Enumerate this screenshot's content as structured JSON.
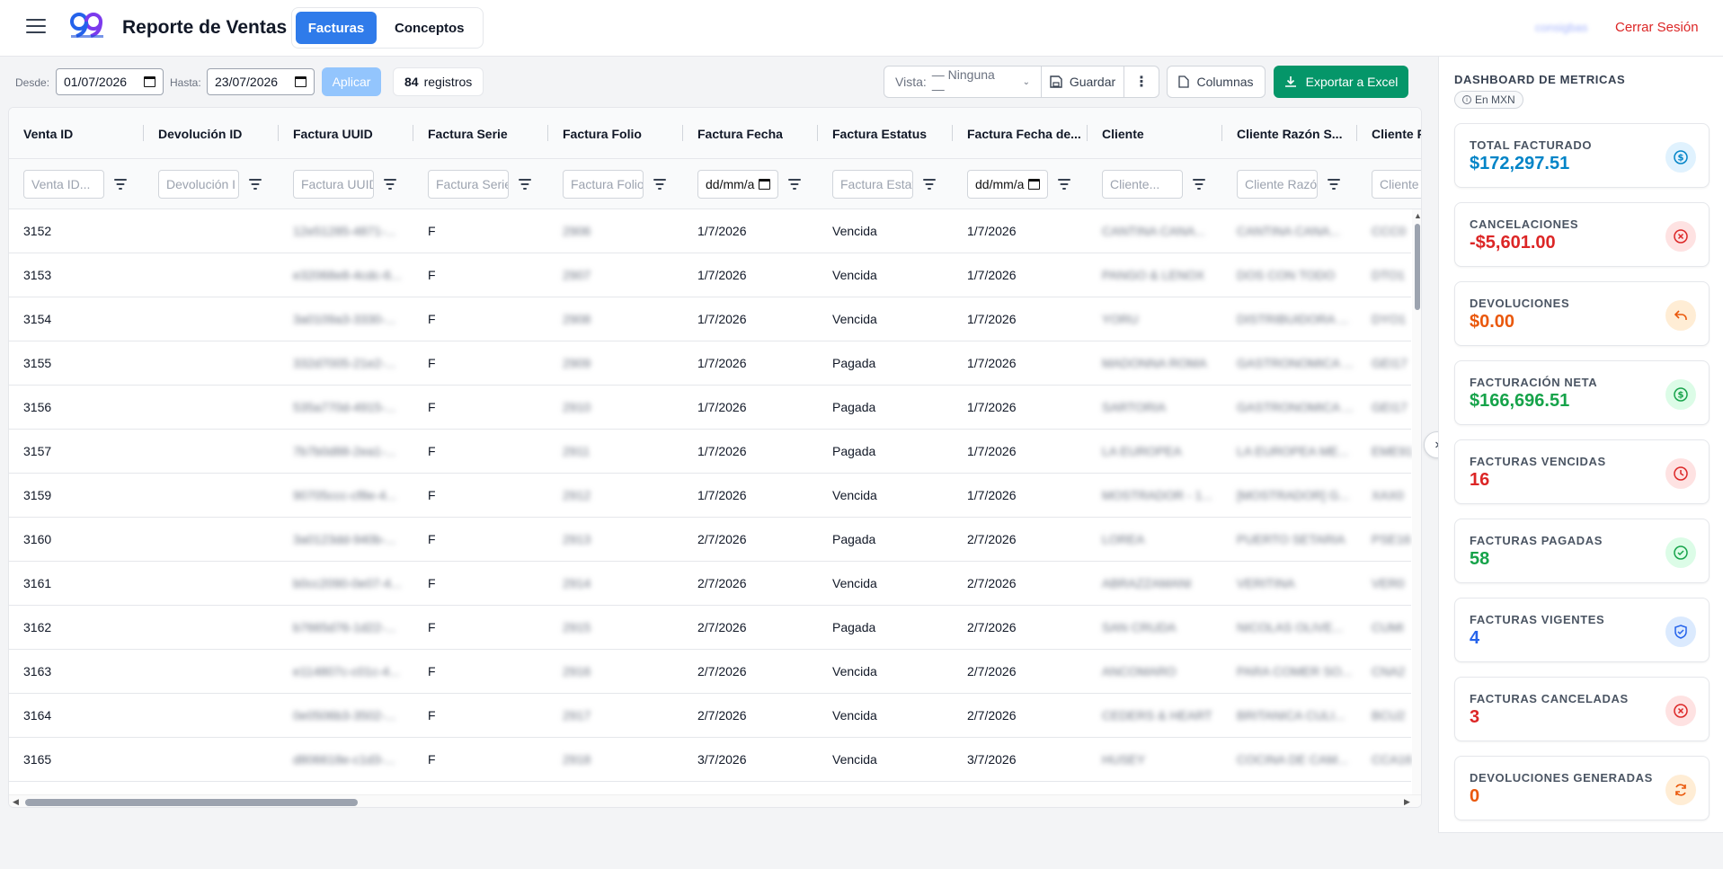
{
  "header": {
    "title": "Reporte de Ventas",
    "tabs": [
      {
        "label": "Facturas"
      },
      {
        "label": "Conceptos"
      }
    ],
    "user": "consigbas",
    "logout": "Cerrar Sesión"
  },
  "toolbar": {
    "desde_label": "Desde:",
    "desde_value": "01/07/2026",
    "hasta_label": "Hasta:",
    "hasta_value": "23/07/2026",
    "apply": "Aplicar",
    "count": "84",
    "count_label": "registros",
    "view_label": "Vista:",
    "view_value": "— Ninguna —",
    "save": "Guardar",
    "columns": "Columnas",
    "export": "Exportar a Excel"
  },
  "grid": {
    "columns": [
      "Venta ID",
      "Devolución ID",
      "Factura UUID",
      "Factura Serie",
      "Factura Folio",
      "Factura Fecha",
      "Factura Estatus",
      "Factura Fecha de...",
      "Cliente",
      "Cliente Razón S...",
      "Cliente R"
    ],
    "filters": [
      "Venta ID...",
      "Devolución I",
      "Factura UUID",
      "Factura Serie",
      "Factura Folio",
      "dd/mm/a",
      "Factura Estat",
      "dd/mm/a",
      "Cliente...",
      "Cliente Razó",
      "Cliente"
    ],
    "rows": [
      [
        "3152",
        "",
        "12e51285-4871-...",
        "F",
        "2906",
        "1/7/2026",
        "Vencida",
        "1/7/2026",
        "CANTINA CANA...",
        "CANTINA CANA...",
        "CCC0"
      ],
      [
        "3153",
        "",
        "e32068e8-4cdc-6...",
        "F",
        "2907",
        "1/7/2026",
        "Vencida",
        "1/7/2026",
        "PANGO & LENOX",
        "DOS CON TODO",
        "DTO1"
      ],
      [
        "3154",
        "",
        "3a0109a3-3330-...",
        "F",
        "2908",
        "1/7/2026",
        "Vencida",
        "1/7/2026",
        "YORU",
        "DISTRIBUIDORA ...",
        "DYO1"
      ],
      [
        "3155",
        "",
        "332d7005-21e2-...",
        "F",
        "2909",
        "1/7/2026",
        "Pagada",
        "1/7/2026",
        "MADONNA ROMA",
        "GASTRONOMICA ...",
        "GEI17"
      ],
      [
        "3156",
        "",
        "535a770d-4915-...",
        "F",
        "2910",
        "1/7/2026",
        "Pagada",
        "1/7/2026",
        "SARTORIA",
        "GASTRONOMICA ...",
        "GEI17"
      ],
      [
        "3157",
        "",
        "7b7b0d88-2ea1-...",
        "F",
        "2911",
        "1/7/2026",
        "Pagada",
        "1/7/2026",
        "LA EUROPEA",
        "LA EUROPEA ME...",
        "EME91"
      ],
      [
        "3159",
        "",
        "90705ccc-cf8e-4...",
        "F",
        "2912",
        "1/7/2026",
        "Vencida",
        "1/7/2026",
        "MOSTRADOR - 1...",
        "[MOSTRADOR] G...",
        "XAX0"
      ],
      [
        "3160",
        "",
        "3a0123dd-940b-...",
        "F",
        "2913",
        "2/7/2026",
        "Pagada",
        "2/7/2026",
        "LOREA",
        "PUERTO SETARIA",
        "PSE16"
      ],
      [
        "3161",
        "",
        "b0cc2090-0e07-4...",
        "F",
        "2914",
        "2/7/2026",
        "Vencida",
        "2/7/2026",
        "ABRAZZAMANI",
        "VERITINA",
        "VER0"
      ],
      [
        "3162",
        "",
        "b7665d76-1d22-...",
        "F",
        "2915",
        "2/7/2026",
        "Pagada",
        "2/7/2026",
        "SAN CRUDA",
        "NICOLAS OLIVE...",
        "CUMI"
      ],
      [
        "3163",
        "",
        "e114807c-c01c-4...",
        "F",
        "2916",
        "2/7/2026",
        "Vencida",
        "2/7/2026",
        "ANCOMARO",
        "PARA COMER SO...",
        "CNA2"
      ],
      [
        "3164",
        "",
        "0e0506b3-3502-...",
        "F",
        "2917",
        "2/7/2026",
        "Vencida",
        "2/7/2026",
        "CEDERS & HEART",
        "BRITANICA CULI...",
        "BCU2"
      ],
      [
        "3165",
        "",
        "d806618e-c1d3-...",
        "F",
        "2918",
        "3/7/2026",
        "Vencida",
        "3/7/2026",
        "HUSEY",
        "COCINA DE CAM...",
        "CCA16"
      ]
    ]
  },
  "dashboard": {
    "title": "DASHBOARD DE METRICAS",
    "badge": "En MXN",
    "cards": [
      {
        "label": "TOTAL FACTURADO",
        "value": "$172,297.51",
        "color": "#0284c7",
        "bg": "#e0f2fe",
        "icon": "dollar-circle-icon"
      },
      {
        "label": "CANCELACIONES",
        "value": "-$5,601.00",
        "color": "#dc2626",
        "bg": "#fee2e2",
        "icon": "x-circle-icon"
      },
      {
        "label": "DEVOLUCIONES",
        "value": "$0.00",
        "color": "#ea580c",
        "bg": "#ffedd5",
        "icon": "undo-icon"
      },
      {
        "label": "FACTURACIÓN NETA",
        "value": "$166,696.51",
        "color": "#16a34a",
        "bg": "#dcfce7",
        "icon": "dollar-circle-icon"
      },
      {
        "label": "FACTURAS VENCIDAS",
        "value": "16",
        "color": "#dc2626",
        "bg": "#fee2e2",
        "icon": "clock-icon"
      },
      {
        "label": "FACTURAS PAGADAS",
        "value": "58",
        "color": "#16a34a",
        "bg": "#dcfce7",
        "icon": "check-circle-icon"
      },
      {
        "label": "FACTURAS VIGENTES",
        "value": "4",
        "color": "#2563eb",
        "bg": "#dbeafe",
        "icon": "shield-check-icon"
      },
      {
        "label": "FACTURAS CANCELADAS",
        "value": "3",
        "color": "#dc2626",
        "bg": "#fee2e2",
        "icon": "x-circle-icon"
      },
      {
        "label": "DEVOLUCIONES GENERADAS",
        "value": "0",
        "color": "#ea580c",
        "bg": "#ffedd5",
        "icon": "refresh-icon"
      }
    ]
  }
}
